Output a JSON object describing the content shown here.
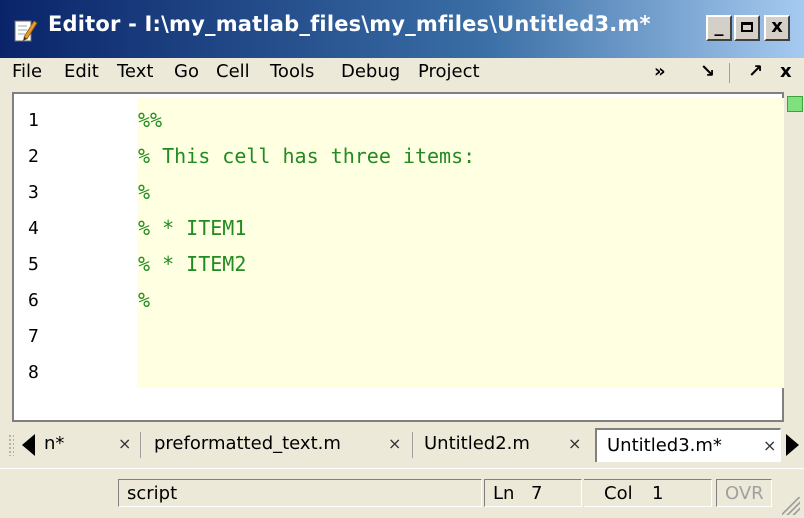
{
  "window": {
    "title": "Editor - I:\\my_matlab_files\\my_mfiles\\Untitled3.m*",
    "controls": {
      "minimize": "_",
      "maximize": "□",
      "close": "x"
    },
    "icons": {
      "app": "editor-page-icon"
    }
  },
  "menubar": {
    "items": [
      "File",
      "Edit",
      "Text",
      "Go",
      "Cell",
      "Tools",
      "Debug",
      "Project"
    ],
    "overflow": "»",
    "dock": "↘",
    "undock": "↗",
    "close": "x"
  },
  "editor": {
    "line_numbers": [
      "1",
      "2",
      "3",
      "4",
      "5",
      "6",
      "7",
      "8"
    ],
    "lines": [
      "%%",
      "% This cell has three items:",
      "%",
      "% * ITEM1",
      "% * ITEM2",
      "%",
      "",
      ""
    ],
    "colors": {
      "comment": "#228b22",
      "cell_highlight": "#ffffe1"
    }
  },
  "tabs": [
    {
      "label": "n*",
      "close": "×"
    },
    {
      "label": "preformatted_text.m",
      "close": "×"
    },
    {
      "label": "Untitled2.m",
      "close": "×"
    },
    {
      "label": "Untitled3.m*",
      "close": "×",
      "active": true
    }
  ],
  "status": {
    "mode": "script",
    "line_label": "Ln",
    "line_value": "7",
    "col_label": "Col",
    "col_value": "1",
    "ovr": "OVR"
  }
}
